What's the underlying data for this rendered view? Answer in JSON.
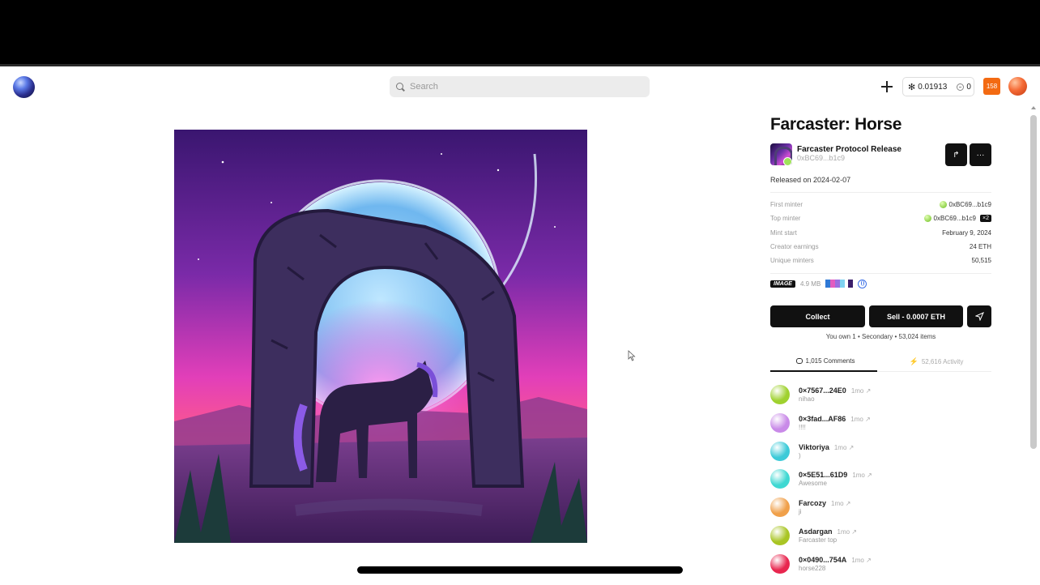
{
  "header": {
    "search_placeholder": "Search",
    "balance": "0.01913",
    "credits": "0",
    "notifications": "158"
  },
  "nft": {
    "title": "Farcaster: Horse",
    "collection_name": "Farcaster Protocol Release",
    "collection_address": "0xBC69...b1c9",
    "released": "Released on 2024-02-07"
  },
  "details": [
    {
      "key": "First minter",
      "value": "0xBC69...b1c9",
      "dot": true
    },
    {
      "key": "Top minter",
      "value": "0xBC69...b1c9",
      "dot": true,
      "badge": "×2"
    },
    {
      "key": "Mint start",
      "value": "February 9, 2024"
    },
    {
      "key": "Creator earnings",
      "value": "24 ETH"
    },
    {
      "key": "Unique minters",
      "value": "50,515"
    }
  ],
  "media": {
    "type_badge": "IMAGE",
    "size": "4.9 MB",
    "swatches": [
      "#2f79d6",
      "#e35cc0",
      "#9b6ee0",
      "#7fd2f0",
      "#ffffff",
      "#3b1f6b"
    ]
  },
  "actions": {
    "collect": "Collect",
    "sell": "Sell - 0.0007 ETH",
    "ownership": "You own 1 • Secondary • 53,024 items"
  },
  "tabs": {
    "comments": "1,015 Comments",
    "activity": "52,616 Activity"
  },
  "comments": [
    {
      "name": "0×7567...24E0",
      "time": "1mo ↗",
      "text": "nihao",
      "color": "#9fd12f"
    },
    {
      "name": "0×3fad...AF86",
      "time": "1mo ↗",
      "text": "!!!!",
      "color": "#c98ae8"
    },
    {
      "name": "Viktoriya",
      "time": "1mo ↗",
      "text": ")",
      "color": "#3ccad8"
    },
    {
      "name": "0×5E51...61D9",
      "time": "1mo ↗",
      "text": "Awesome",
      "color": "#3fd8d2"
    },
    {
      "name": "Farcozy",
      "time": "1mo ↗",
      "text": "ji",
      "color": "#f0a04a"
    },
    {
      "name": "Asdargan",
      "time": "1mo ↗",
      "text": "Farcaster top",
      "color": "#a9c524"
    },
    {
      "name": "0×0490...754A",
      "time": "1mo ↗",
      "text": "horse228",
      "color": "#e8264f"
    }
  ]
}
